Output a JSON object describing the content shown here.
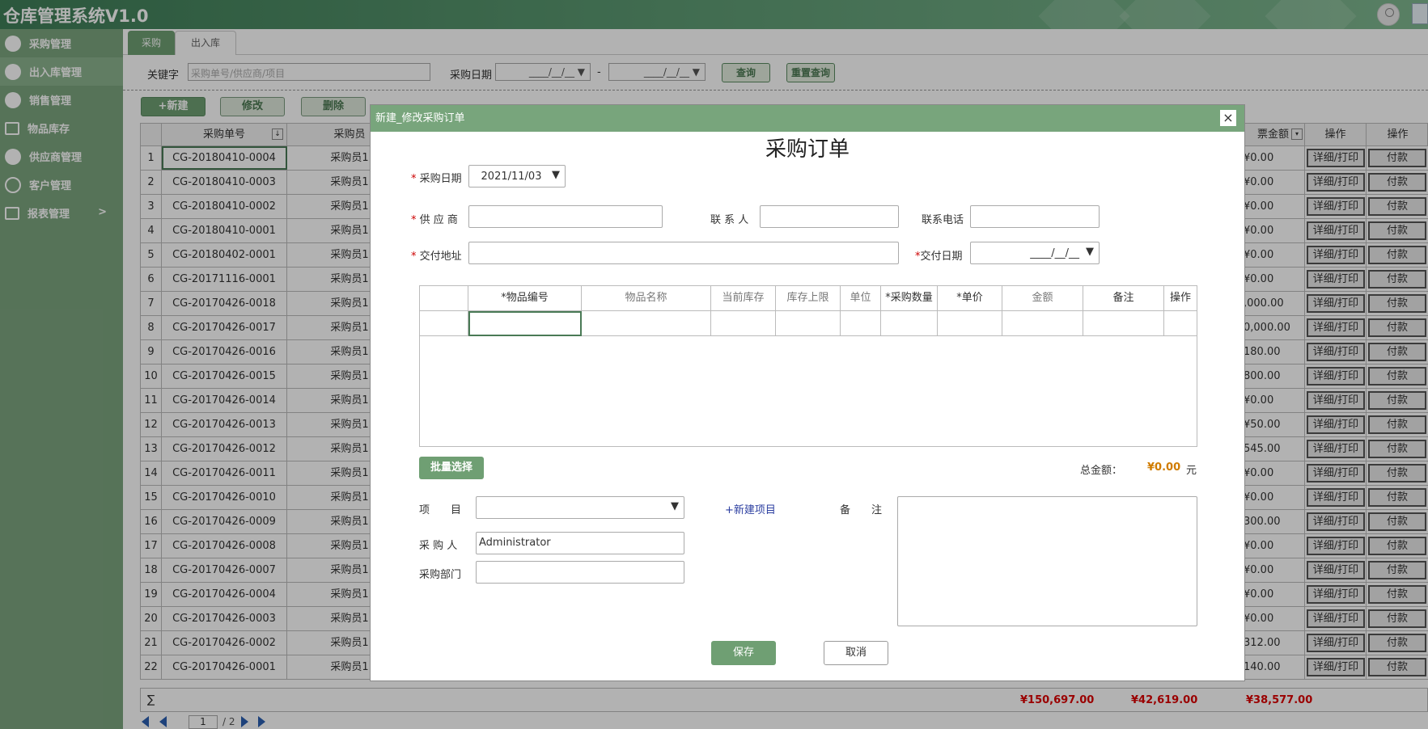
{
  "app": {
    "title": "仓库管理系统V1.0"
  },
  "sidebar": {
    "items": [
      {
        "label": "采购管理"
      },
      {
        "label": "出入库管理"
      },
      {
        "label": "销售管理"
      },
      {
        "label": "物品库存"
      },
      {
        "label": "供应商管理"
      },
      {
        "label": "客户管理"
      },
      {
        "label": "报表管理",
        "arrow": ">"
      }
    ]
  },
  "tabs": [
    {
      "label": "采购"
    },
    {
      "label": "出入库"
    }
  ],
  "filter": {
    "keyword_label": "关键字",
    "keyword_placeholder": "采购单号/供应商/项目",
    "date_label": "采购日期",
    "date_start": "____/__/__",
    "date_sep": "-",
    "date_end": "____/__/__",
    "query_label": "查询",
    "reset_label": "重置查询"
  },
  "actions": {
    "new_label": "+新建",
    "edit_label": "修改",
    "delete_label": "删除"
  },
  "grid": {
    "headers": {
      "order_no": "采购单号",
      "buyer": "采购员",
      "invoice_amount": "票金额",
      "op1": "操作",
      "op2": "操作"
    },
    "rows": [
      {
        "num": "1",
        "order_no": "CG-20180410-0004",
        "buyer": "采购员1",
        "amount": "¥0.00"
      },
      {
        "num": "2",
        "order_no": "CG-20180410-0003",
        "buyer": "采购员1",
        "amount": "¥0.00"
      },
      {
        "num": "3",
        "order_no": "CG-20180410-0002",
        "buyer": "采购员1",
        "amount": "¥0.00"
      },
      {
        "num": "4",
        "order_no": "CG-20180410-0001",
        "buyer": "采购员1",
        "amount": "¥0.00"
      },
      {
        "num": "5",
        "order_no": "CG-20180402-0001",
        "buyer": "采购员1",
        "amount": "¥0.00"
      },
      {
        "num": "6",
        "order_no": "CG-20171116-0001",
        "buyer": "采购员1",
        "amount": "¥0.00"
      },
      {
        "num": "7",
        "order_no": "CG-20170426-0018",
        "buyer": "采购员1",
        "amount": ",000.00"
      },
      {
        "num": "8",
        "order_no": "CG-20170426-0017",
        "buyer": "采购员1",
        "amount": "0,000.00"
      },
      {
        "num": "9",
        "order_no": "CG-20170426-0016",
        "buyer": "采购员1",
        "amount": "180.00"
      },
      {
        "num": "10",
        "order_no": "CG-20170426-0015",
        "buyer": "采购员1",
        "amount": "800.00"
      },
      {
        "num": "11",
        "order_no": "CG-20170426-0014",
        "buyer": "采购员1",
        "amount": "¥0.00"
      },
      {
        "num": "12",
        "order_no": "CG-20170426-0013",
        "buyer": "采购员1",
        "amount": "¥50.00"
      },
      {
        "num": "13",
        "order_no": "CG-20170426-0012",
        "buyer": "采购员1",
        "amount": "545.00"
      },
      {
        "num": "14",
        "order_no": "CG-20170426-0011",
        "buyer": "采购员1",
        "amount": "¥0.00"
      },
      {
        "num": "15",
        "order_no": "CG-20170426-0010",
        "buyer": "采购员1",
        "amount": "¥0.00"
      },
      {
        "num": "16",
        "order_no": "CG-20170426-0009",
        "buyer": "采购员1",
        "amount": "300.00"
      },
      {
        "num": "17",
        "order_no": "CG-20170426-0008",
        "buyer": "采购员1",
        "amount": "¥0.00"
      },
      {
        "num": "18",
        "order_no": "CG-20170426-0007",
        "buyer": "采购员1",
        "amount": "¥0.00"
      },
      {
        "num": "19",
        "order_no": "CG-20170426-0004",
        "buyer": "采购员1",
        "amount": "¥0.00"
      },
      {
        "num": "20",
        "order_no": "CG-20170426-0003",
        "buyer": "采购员1",
        "amount": "¥0.00"
      },
      {
        "num": "21",
        "order_no": "CG-20170426-0002",
        "buyer": "采购员1",
        "amount": "312.00"
      },
      {
        "num": "22",
        "order_no": "CG-20170426-0001",
        "buyer": "采购员1",
        "amount": "140.00"
      }
    ],
    "row_btn1": "详细/打印",
    "row_btn2": "付款",
    "sum_sign": "∑",
    "totals": [
      "¥150,697.00",
      "¥42,619.00",
      "¥38,577.00"
    ]
  },
  "pager": {
    "page": "1",
    "total": "/ 2"
  },
  "dialog": {
    "header": "新建_修改采购订单",
    "close": "×",
    "title": "采购订单",
    "purchase_date_label": "采购日期",
    "purchase_date_value": "2021/11/03",
    "supplier_label": "供 应 商",
    "contact_label": "联 系 人",
    "phone_label": "联系电话",
    "delivery_addr_label": "交付地址",
    "delivery_date_label": "交付日期",
    "delivery_date_value": "____/__/__",
    "item_headers": [
      "*物品编号",
      "物品名称",
      "当前库存",
      "库存上限",
      "单位",
      "*采购数量",
      "*单价",
      "金额",
      "备注",
      "操作"
    ],
    "batch_label": "批量选择",
    "total_label": "总金额：",
    "total_value": "¥0.00",
    "total_unit": "元",
    "project_label": "项　　目",
    "new_project_link": "+新建项目",
    "remark_label": "备　　注",
    "buyer_label": "采 购 人",
    "buyer_value": "Administrator",
    "dept_label": "采购部门",
    "save_label": "保存",
    "cancel_label": "取消"
  }
}
